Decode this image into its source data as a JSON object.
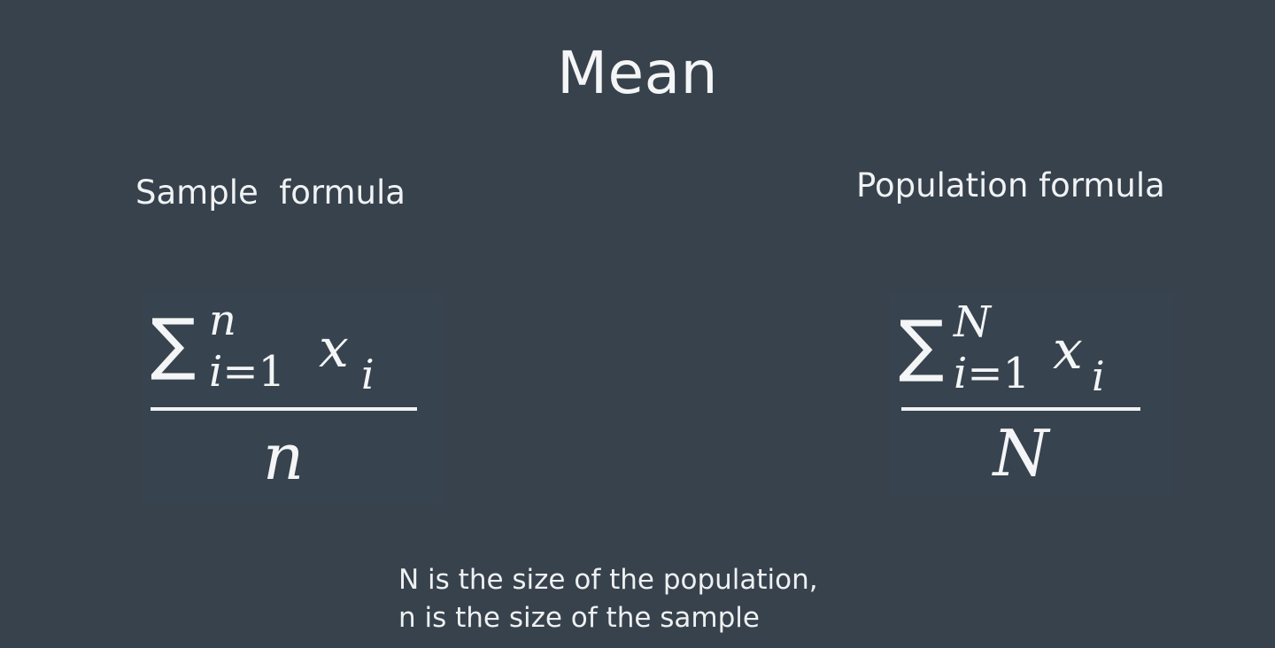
{
  "slide": {
    "title": "Mean",
    "sample_label": "Sample  formula",
    "population_label": "Population formula",
    "sample_formula": {
      "sigma": "∑",
      "upper": "n",
      "lower_var": "i",
      "lower_rest": "=1",
      "term": "x",
      "term_sub": "i",
      "denominator": "n"
    },
    "population_formula": {
      "sigma": "∑",
      "upper": "N",
      "lower_var": "i",
      "lower_rest": "=1",
      "term": "x",
      "term_sub": "i",
      "denominator": "N"
    },
    "note_line1": "N is the size of the population,",
    "note_line2": "n is the size of the sample"
  },
  "colors": {
    "background": "#37424d",
    "text": "#f2f4f5"
  }
}
